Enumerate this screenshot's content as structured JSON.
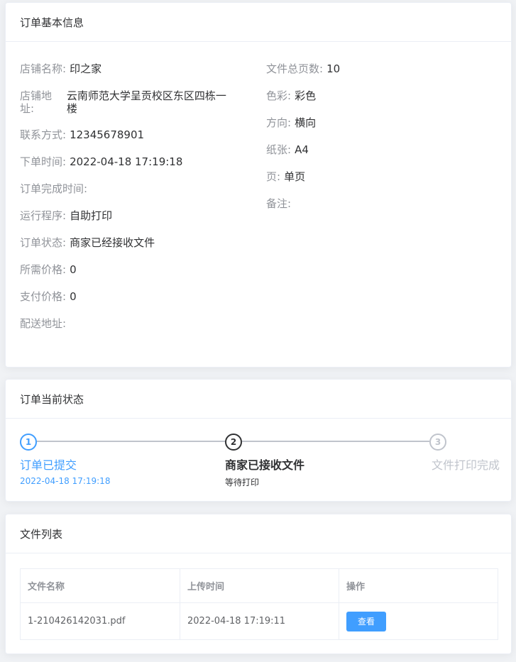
{
  "info_card": {
    "title": "订单基本信息",
    "left": [
      {
        "label": "店铺名称:",
        "value": "印之家"
      },
      {
        "label": "店铺地址:",
        "value": "云南师范大学呈贡校区东区四栋一楼"
      },
      {
        "label": "联系方式:",
        "value": "12345678901"
      },
      {
        "label": "下单时间:",
        "value": "2022-04-18 17:19:18"
      },
      {
        "label": "订单完成时间:",
        "value": ""
      },
      {
        "label": "运行程序:",
        "value": "自助打印"
      },
      {
        "label": "订单状态:",
        "value": "商家已经接收文件"
      },
      {
        "label": "所需价格:",
        "value": "0"
      },
      {
        "label": "支付价格:",
        "value": "0"
      },
      {
        "label": "配送地址:",
        "value": ""
      }
    ],
    "right": [
      {
        "label": "文件总页数:",
        "value": "10"
      },
      {
        "label": "色彩:",
        "value": "彩色"
      },
      {
        "label": "方向:",
        "value": "横向"
      },
      {
        "label": "纸张:",
        "value": "A4"
      },
      {
        "label": "页:",
        "value": "单页"
      },
      {
        "label": "备注:",
        "value": ""
      }
    ]
  },
  "status_card": {
    "title": "订单当前状态",
    "steps": [
      {
        "num": "1",
        "title": "订单已提交",
        "desc": "2022-04-18 17:19:18"
      },
      {
        "num": "2",
        "title": "商家已接收文件",
        "desc": "等待打印"
      },
      {
        "num": "3",
        "title": "文件打印完成",
        "desc": ""
      }
    ]
  },
  "files_card": {
    "title": "文件列表",
    "headers": [
      "文件名称",
      "上传时间",
      "操作"
    ],
    "rows": [
      {
        "name": "1-210426142031.pdf",
        "time": "2022-04-18 17:19:11",
        "action": "查看"
      }
    ]
  },
  "colors": {
    "primary": "#409eff",
    "process": "#303133",
    "wait": "#c0c4cc"
  }
}
